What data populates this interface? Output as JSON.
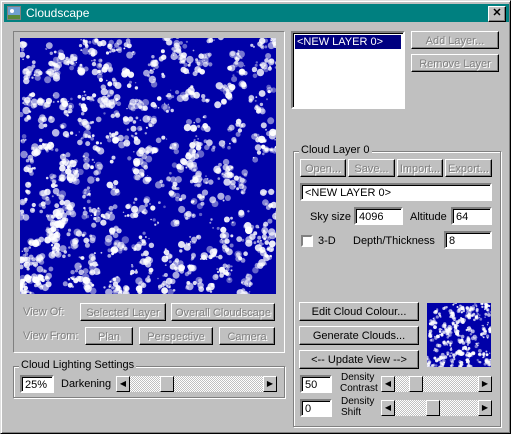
{
  "window": {
    "title": "Cloudscape",
    "close_symbol": "✕"
  },
  "layers": {
    "items": [
      "<NEW LAYER 0>"
    ],
    "add_label": "Add Layer...",
    "remove_label": "Remove Layer"
  },
  "cloud_layer": {
    "group_label": "Cloud Layer 0",
    "open_label": "Open...",
    "save_label": "Save...",
    "import_label": "Import...",
    "export_label": "Export...",
    "name_value": "<NEW LAYER 0>",
    "sky_size_label": "Sky size",
    "sky_size_value": "4096",
    "altitude_label": "Altitude",
    "altitude_value": "64",
    "three_d_label": "3-D",
    "three_d_checked": false,
    "depth_label": "Depth/Thickness",
    "depth_value": "8",
    "edit_colour_label": "Edit Cloud Colour...",
    "generate_label": "Generate Clouds...",
    "update_view_label": "<-- Update View -->",
    "density_contrast_value": "50",
    "density_contrast_label_1": "Density",
    "density_contrast_label_2": "Contrast",
    "density_shift_value": "0",
    "density_shift_label_1": "Density",
    "density_shift_label_2": "Shift",
    "contrast_level": 0.2,
    "shift_level": 0.45
  },
  "view": {
    "view_of_label": "View Of:",
    "selected_layer_label": "Selected Layer",
    "overall_label": "Overall Cloudscape",
    "view_from_label": "View From:",
    "plan_label": "Plan",
    "perspective_label": "Perspective",
    "camera_label": "Camera"
  },
  "lighting": {
    "group_label": "Cloud Lighting Settings",
    "darkening_value": "25%",
    "darkening_label": "Darkening",
    "darkening_level": 0.25
  },
  "colors": {
    "sky": "#0000a8",
    "cloud": "#ffffff",
    "title": "#008080",
    "selection": "#000080"
  }
}
